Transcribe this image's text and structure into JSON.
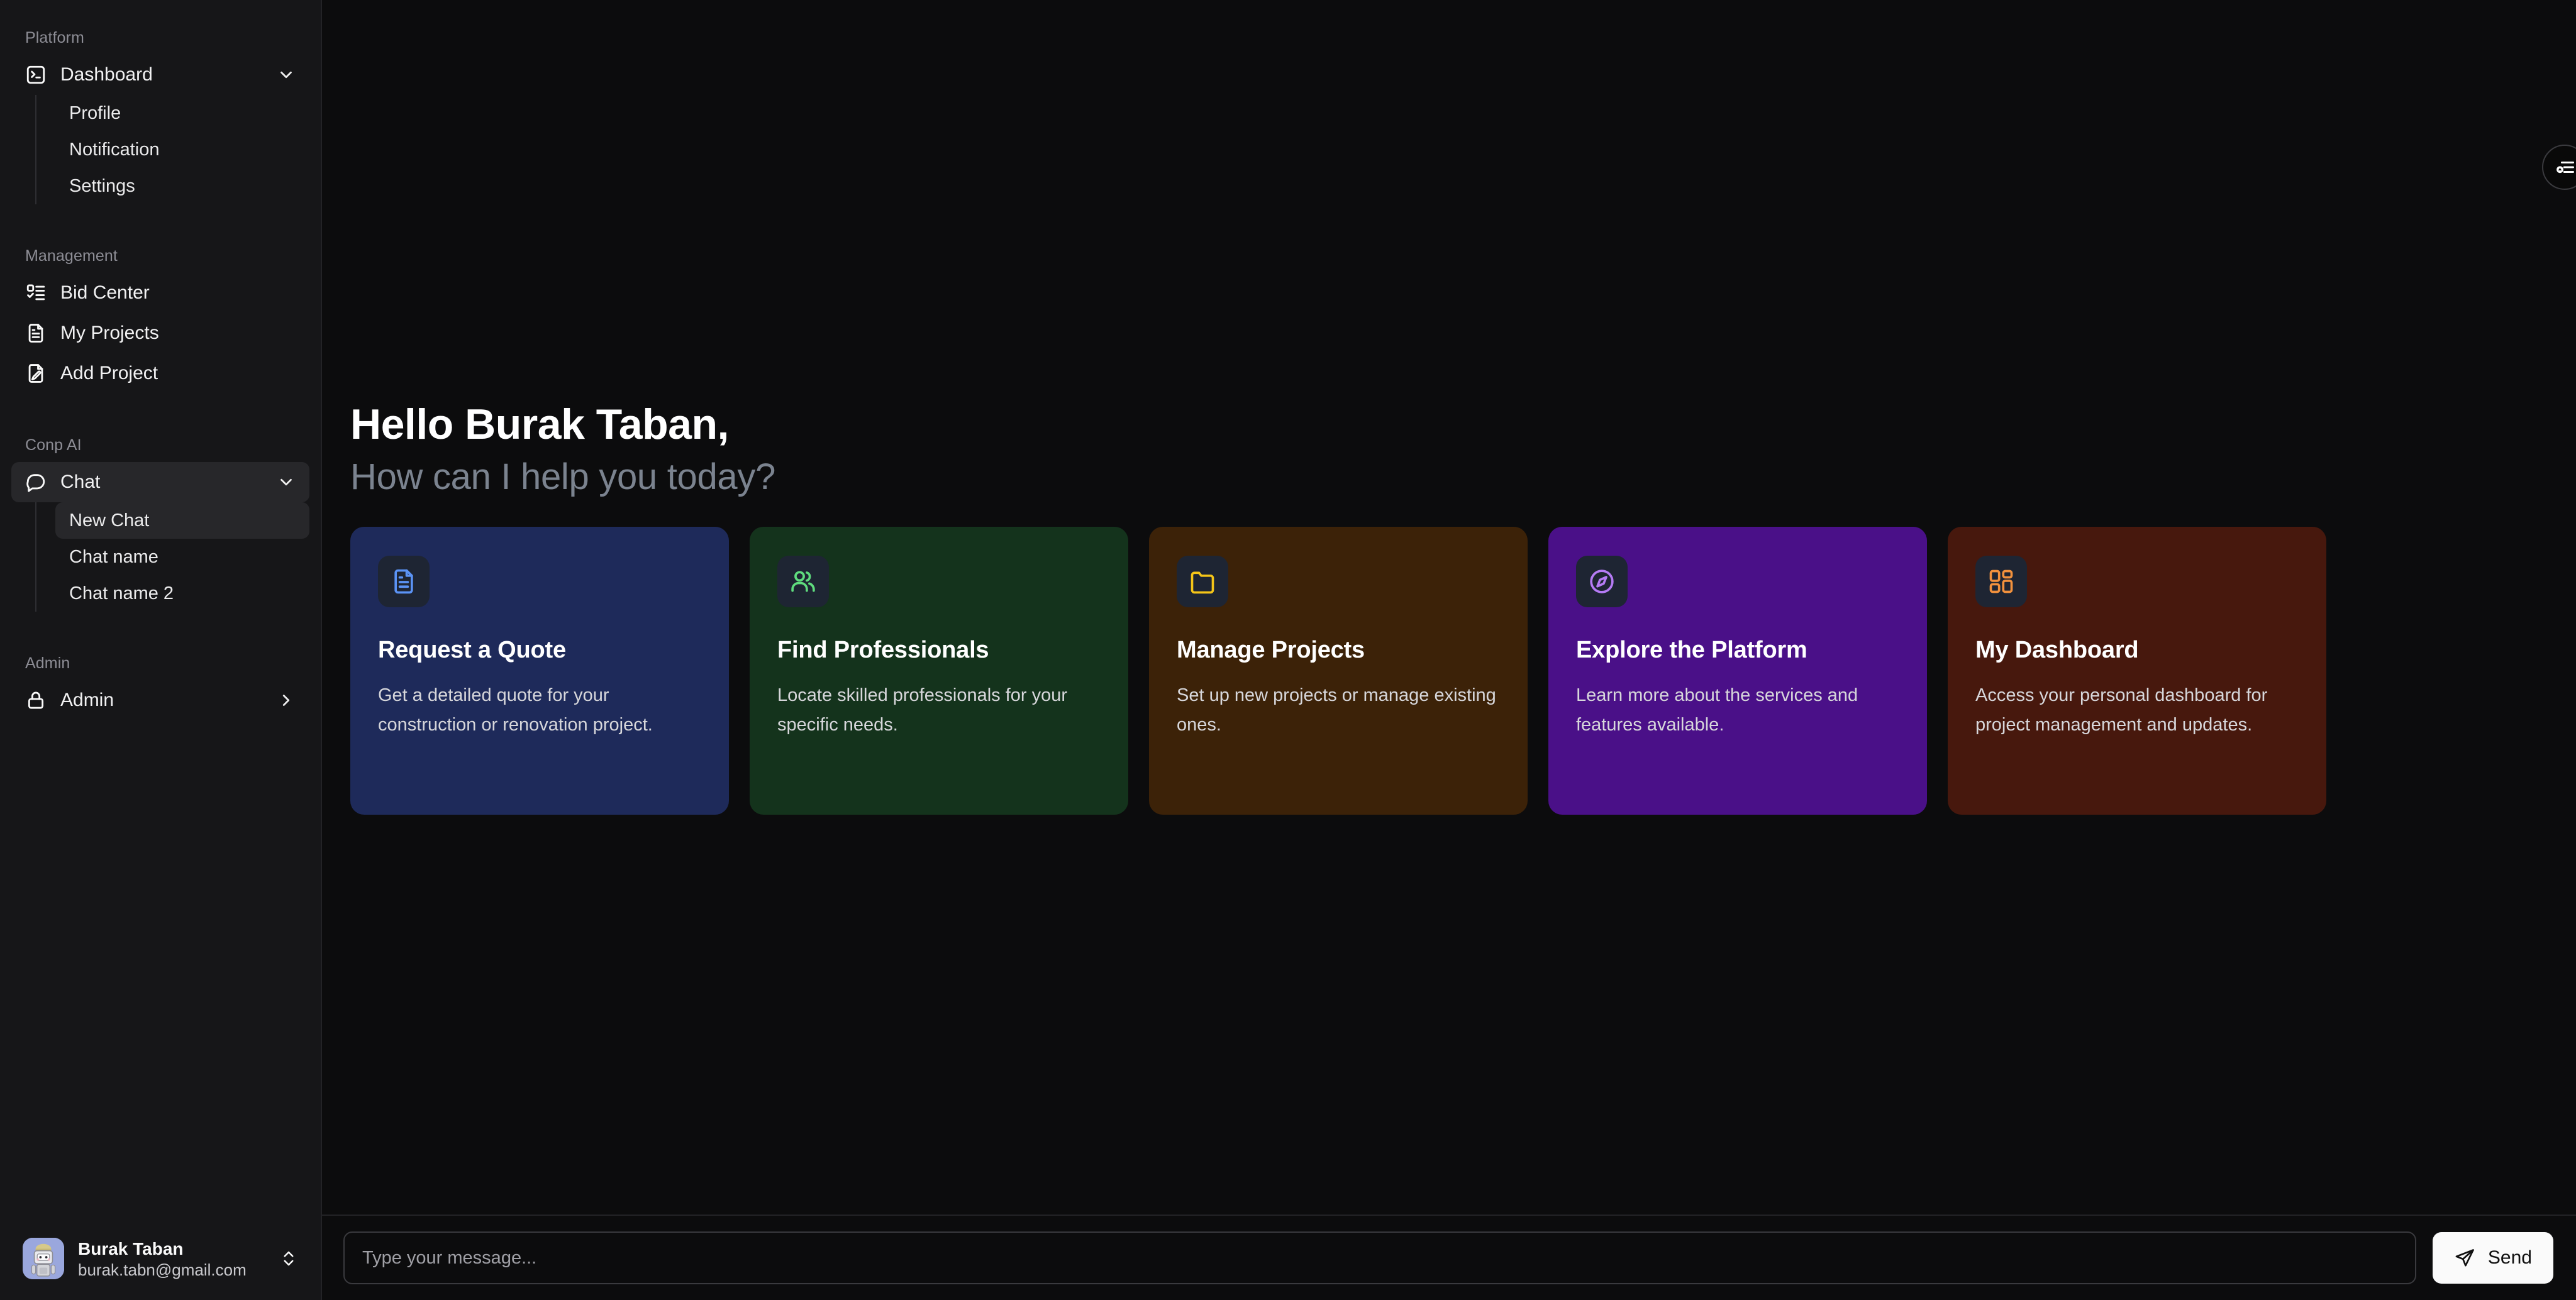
{
  "sidebar": {
    "groups": [
      {
        "label": "Platform",
        "items": [
          {
            "label": "Dashboard",
            "icon": "square-terminal-icon",
            "expandable": true,
            "active": false,
            "children": [
              {
                "label": "Profile",
                "active": false
              },
              {
                "label": "Notification",
                "active": false
              },
              {
                "label": "Settings",
                "active": false
              }
            ]
          }
        ]
      },
      {
        "label": "Management",
        "items": [
          {
            "label": "Bid Center",
            "icon": "list-checks-icon",
            "expandable": false,
            "active": false
          },
          {
            "label": "My Projects",
            "icon": "file-text-icon",
            "expandable": false,
            "active": false
          },
          {
            "label": "Add Project",
            "icon": "file-pen-icon",
            "expandable": false,
            "active": false
          }
        ]
      },
      {
        "label": "Conp AI",
        "items": [
          {
            "label": "Chat",
            "icon": "message-square-icon",
            "expandable": true,
            "active": true,
            "children": [
              {
                "label": "New Chat",
                "active": true
              },
              {
                "label": "Chat name",
                "active": false
              },
              {
                "label": "Chat name 2",
                "active": false
              }
            ]
          }
        ]
      },
      {
        "label": "Admin",
        "items": [
          {
            "label": "Admin",
            "icon": "lock-icon",
            "expandable": false,
            "collapsed": true,
            "active": false
          }
        ]
      }
    ],
    "user": {
      "name": "Burak Taban",
      "email": "burak.tabn@gmail.com",
      "avatar_icon": "robot-avatar",
      "toggle_icon": "chevrons-up-down-icon"
    }
  },
  "main": {
    "float_button_icon": "settings-sliders-icon",
    "greeting": {
      "hello": "Hello Burak Taban,",
      "subtitle": "How can I help you today?"
    },
    "cards": [
      {
        "title": "Request a Quote",
        "desc": "Get a detailed quote for your construction or renovation project.",
        "icon": "file-text-icon",
        "bg": "#1e2a5a",
        "icon_bg": "#1e2533",
        "icon_color": "#5b93f5"
      },
      {
        "title": "Find Professionals",
        "desc": "Locate skilled professionals for your specific needs.",
        "icon": "users-icon",
        "bg": "#14331c",
        "icon_bg": "#1e2533",
        "icon_color": "#5fdc7e"
      },
      {
        "title": "Manage Projects",
        "desc": "Set up new projects or manage existing ones.",
        "icon": "folder-icon",
        "bg": "#3c2208",
        "icon_bg": "#1e2533",
        "icon_color": "#f5c518"
      },
      {
        "title": "Explore the Platform",
        "desc": "Learn more about the services and features available.",
        "icon": "compass-icon",
        "bg": "#4a1088",
        "icon_bg": "#1e2533",
        "icon_color": "#b57bf5"
      },
      {
        "title": "My Dashboard",
        "desc": "Access your personal dashboard for project management and updates.",
        "icon": "layout-grid-icon",
        "bg": "#47180d",
        "icon_bg": "#1e2533",
        "icon_color": "#f2913d"
      }
    ]
  },
  "composer": {
    "placeholder": "Type your message...",
    "value": "",
    "send_label": "Send",
    "send_icon": "send-icon"
  }
}
